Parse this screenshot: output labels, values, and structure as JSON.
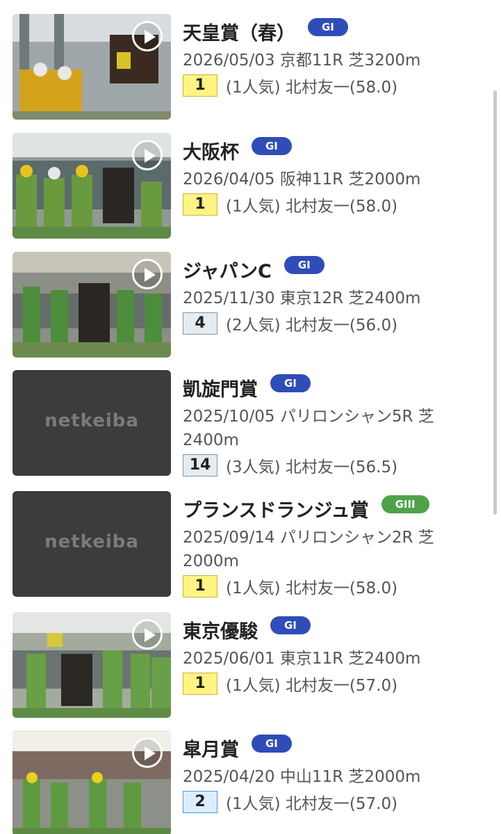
{
  "races": [
    {
      "name": "天皇賞（春）",
      "grade": "GI",
      "grade_color": "#2f4db8",
      "meta": "2026/05/03 京都11R 芝3200m",
      "rank": "1",
      "result": "(1人気) 北村友一(58.0)",
      "thumb": "video",
      "thumb_icon": "play-icon"
    },
    {
      "name": "大阪杯",
      "grade": "GI",
      "grade_color": "#2f4db8",
      "meta": "2026/04/05 阪神11R 芝2000m",
      "rank": "1",
      "result": "(1人気) 北村友一(58.0)",
      "thumb": "video",
      "thumb_icon": "play-icon"
    },
    {
      "name": "ジャパンC",
      "grade": "GI",
      "grade_color": "#2f4db8",
      "meta": "2025/11/30 東京12R 芝2400m",
      "rank": "4",
      "result": "(2人気) 北村友一(56.0)",
      "thumb": "video",
      "thumb_icon": "play-icon"
    },
    {
      "name": "凱旋門賞",
      "grade": "GI",
      "grade_color": "#2f4db8",
      "meta": "2025/10/05 パリロンシャン5R 芝2400m",
      "rank": "14",
      "result": "(3人気) 北村友一(56.5)",
      "thumb": "placeholder",
      "placeholder_text": "netkeiba"
    },
    {
      "name": "プランスドランジュ賞",
      "grade": "GIII",
      "grade_color": "#4fa24a",
      "meta": "2025/09/14 パリロンシャン2R 芝2000m",
      "rank": "1",
      "result": "(1人気) 北村友一(58.0)",
      "thumb": "placeholder",
      "placeholder_text": "netkeiba"
    },
    {
      "name": "東京優駿",
      "grade": "GI",
      "grade_color": "#2f4db8",
      "meta": "2025/06/01 東京11R 芝2400m",
      "rank": "1",
      "result": "(1人気) 北村友一(57.0)",
      "thumb": "video",
      "thumb_icon": "play-icon"
    },
    {
      "name": "皐月賞",
      "grade": "GI",
      "grade_color": "#2f4db8",
      "meta": "2025/04/20 中山11R 芝2000m",
      "rank": "2",
      "result": "(1人気) 北村友一(57.0)",
      "thumb": "video",
      "thumb_icon": "play-icon"
    }
  ],
  "colors": {
    "rank_first_bg": "#fff383",
    "rank_second_bg": "#dcefff",
    "rank_other_bg": "#e4ebf1",
    "placeholder_bg": "#3c3c3c"
  }
}
